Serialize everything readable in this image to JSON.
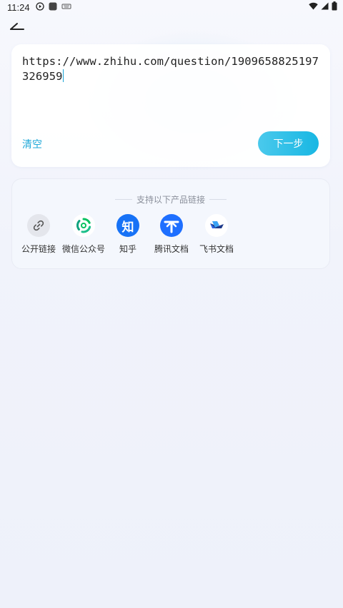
{
  "status_bar": {
    "time": "11:24"
  },
  "input": {
    "url": "https://www.zhihu.com/question/1909658825197326959"
  },
  "actions": {
    "clear_label": "清空",
    "next_label": "下一步"
  },
  "support": {
    "title": "支持以下产品链接",
    "products": [
      {
        "label": "公开链接",
        "icon": "link-icon"
      },
      {
        "label": "微信公众号",
        "icon": "wechat-official-icon"
      },
      {
        "label": "知乎",
        "icon": "zhihu-icon",
        "icon_text": "知"
      },
      {
        "label": "腾讯文档",
        "icon": "tencent-docs-icon"
      },
      {
        "label": "飞书文档",
        "icon": "feishu-docs-icon"
      }
    ]
  },
  "colors": {
    "accent": "#1fa8d8",
    "zhihu_blue": "#1772f6",
    "tencent_blue": "#1e6fff",
    "wechat_green": "#07c160"
  }
}
